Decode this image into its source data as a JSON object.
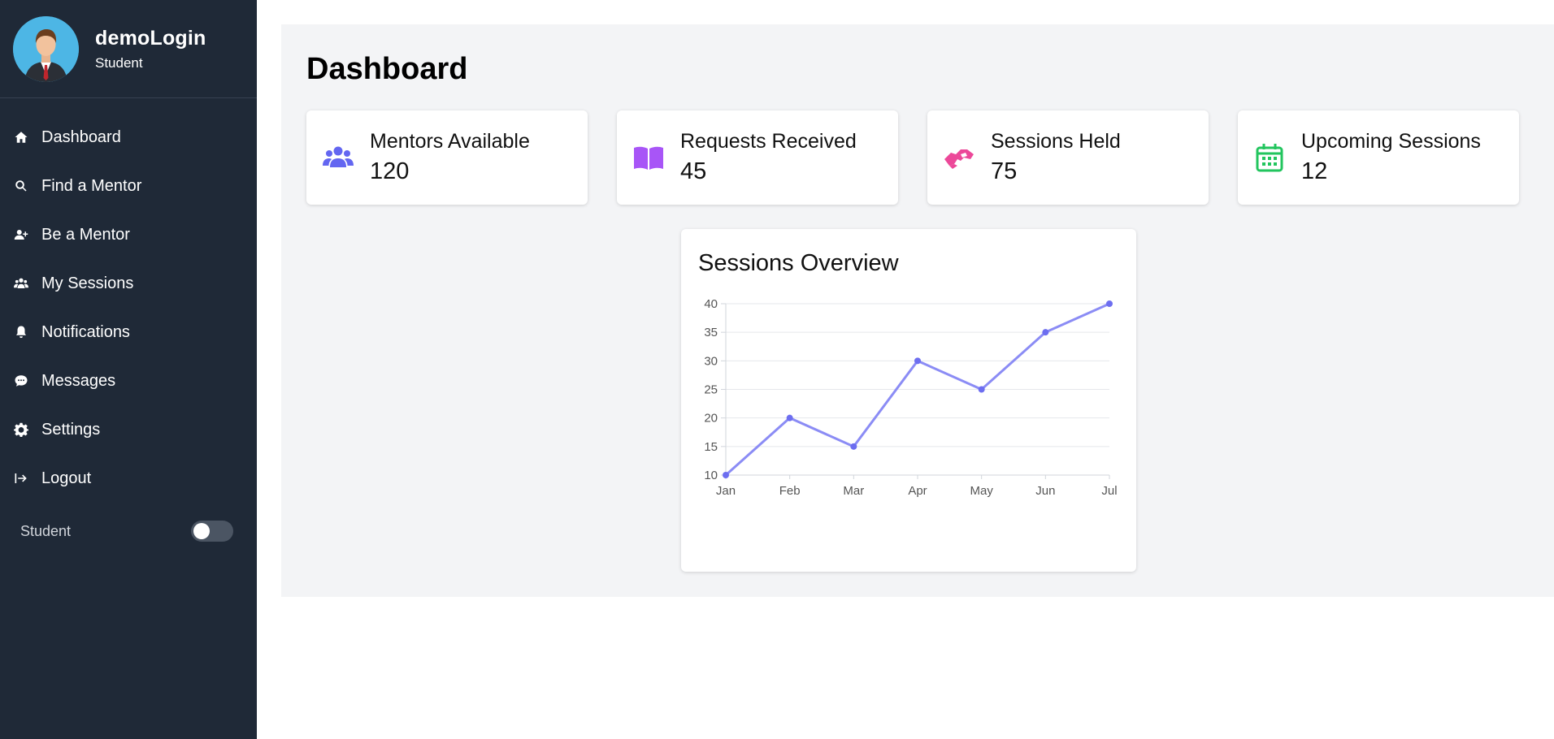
{
  "user": {
    "name": "demoLogin",
    "role": "Student"
  },
  "nav": {
    "items": [
      {
        "label": "Dashboard",
        "icon": "home-icon"
      },
      {
        "label": "Find a Mentor",
        "icon": "search-icon"
      },
      {
        "label": "Be a Mentor",
        "icon": "user-plus-icon"
      },
      {
        "label": "My Sessions",
        "icon": "users-icon"
      },
      {
        "label": "Notifications",
        "icon": "bell-icon"
      },
      {
        "label": "Messages",
        "icon": "comment-icon"
      },
      {
        "label": "Settings",
        "icon": "gear-icon"
      },
      {
        "label": "Logout",
        "icon": "logout-icon"
      }
    ]
  },
  "role_toggle": {
    "label": "Student",
    "on": false
  },
  "page": {
    "title": "Dashboard"
  },
  "stats": [
    {
      "label": "Mentors Available",
      "value": "120",
      "icon": "users-icon",
      "color": "#6366f1"
    },
    {
      "label": "Requests Received",
      "value": "45",
      "icon": "book-open-icon",
      "color": "#a855f7"
    },
    {
      "label": "Sessions Held",
      "value": "75",
      "icon": "handshake-icon",
      "color": "#ec4899"
    },
    {
      "label": "Upcoming Sessions",
      "value": "12",
      "icon": "calendar-icon",
      "color": "#22c55e"
    }
  ],
  "chart_data": {
    "type": "line",
    "title": "Sessions Overview",
    "categories": [
      "Jan",
      "Feb",
      "Mar",
      "Apr",
      "May",
      "Jun",
      "Jul"
    ],
    "series": [
      {
        "values": [
          10,
          20,
          15,
          30,
          25,
          35,
          40
        ],
        "color": "#8b8cf5"
      }
    ],
    "yticks": [
      10,
      15,
      20,
      25,
      30,
      35,
      40
    ],
    "ylim": [
      10,
      40
    ],
    "xlabel": "",
    "ylabel": "",
    "grid": true
  }
}
